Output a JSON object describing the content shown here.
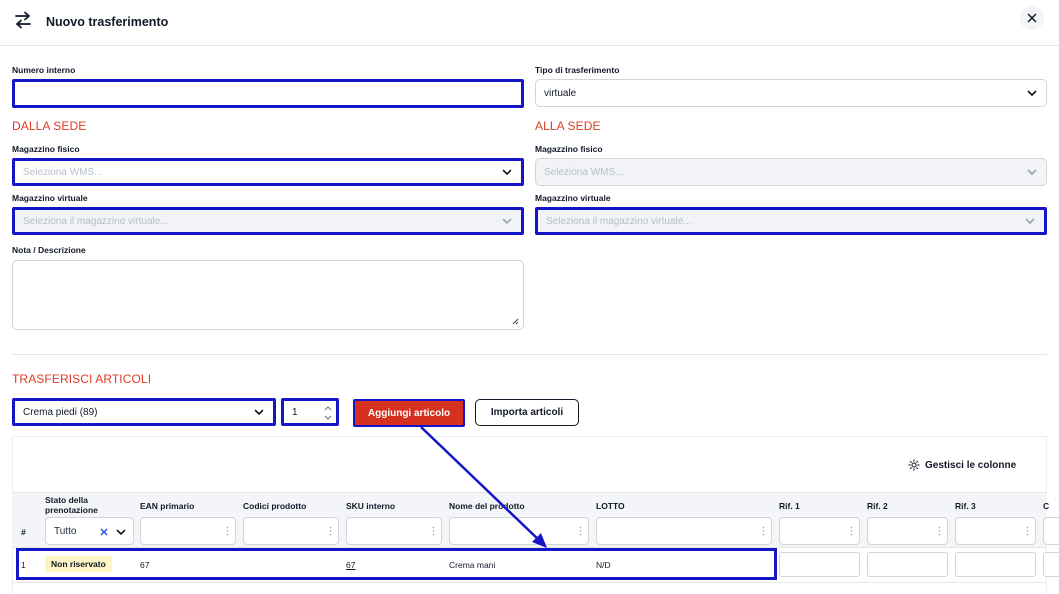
{
  "header": {
    "title": "Nuovo trasferimento",
    "icon": "transfer-arrows-icon",
    "close_icon": "close-icon"
  },
  "form": {
    "numero_interno": {
      "label": "Numero interno",
      "value": ""
    },
    "tipo_trasferimento": {
      "label": "Tipo di trasferimento",
      "value": "virtuale"
    },
    "dalla_sede": {
      "title": "DALLA SEDE",
      "magazzino_fisico": {
        "label": "Magazzino fisico",
        "placeholder": "Seleziona WMS..."
      },
      "magazzino_virtuale": {
        "label": "Magazzino virtuale",
        "placeholder": "Seleziona il magazzino virtuale..."
      }
    },
    "alla_sede": {
      "title": "ALLA SEDE",
      "magazzino_fisico": {
        "label": "Magazzino fisico",
        "placeholder": "Seleziona WMS..."
      },
      "magazzino_virtuale": {
        "label": "Magazzino virtuale",
        "placeholder": "Seleziona il magazzino virtuale..."
      }
    },
    "nota": {
      "label": "Nota / Descrizione",
      "value": ""
    }
  },
  "articoli": {
    "title": "TRASFERISCI ARTICOLI",
    "selected_article": "Crema piedi (89)",
    "quantity": "1",
    "add_label": "Aggiungi articolo",
    "import_label": "Importa articoli",
    "manage_columns": "Gestisci le colonne"
  },
  "table": {
    "columns": {
      "num": "#",
      "stato": "Stato della prenotazione",
      "ean": "EAN primario",
      "codici": "Codici prodotto",
      "sku": "SKU interno",
      "nome": "Nome del prodotto",
      "lotto": "LOTTO",
      "rif1": "Rif. 1",
      "rif2": "Rif. 2",
      "rif3": "Rif. 3",
      "more": "C"
    },
    "stato_filter": "Tutto",
    "rows": [
      {
        "num": "1",
        "stato": "Non riservato",
        "ean": "67",
        "codici": "",
        "sku": "67",
        "nome": "Crema mani",
        "lotto": "N/D"
      }
    ]
  },
  "colors": {
    "accent_red": "#d6301e",
    "section_red": "#dc3c26",
    "highlight_blue": "#1515c8"
  }
}
